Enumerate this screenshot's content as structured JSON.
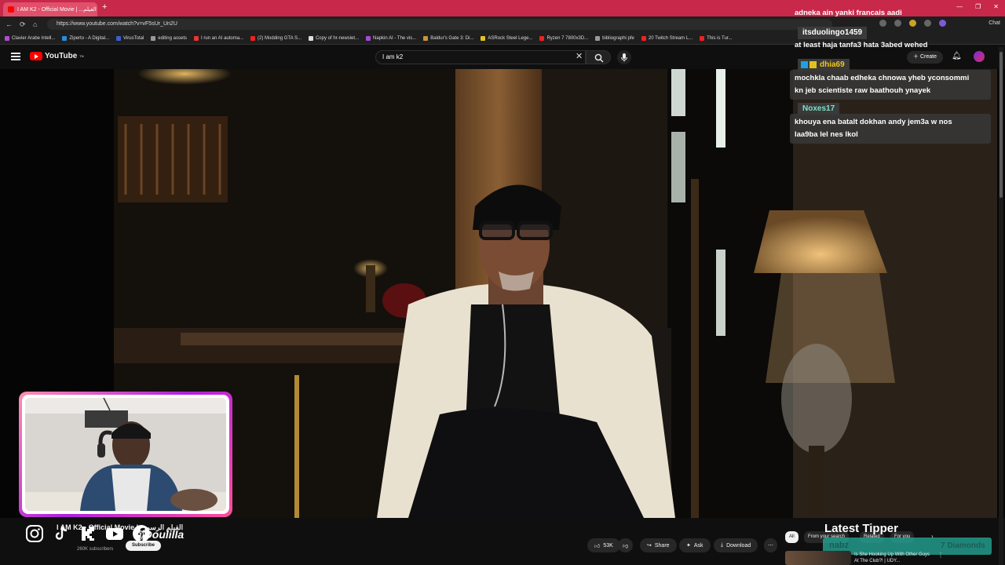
{
  "browser": {
    "tab_title": "I AM K2 - Official Movie | ...الفيلم",
    "url": "https://www.youtube.com/watch?v=vF5sUr_Un2U",
    "chat_label": "Chat",
    "bookmarks": [
      "Clavier Arabe Intell...",
      "Ziperto - A Digital...",
      "VirusTotal",
      "editing assets",
      "I run an AI automa...",
      "(2) Modding GTA S...",
      "Copy of hr-newslet...",
      "Napkin AI - The vis...",
      "Baldur's Gate 3: Di...",
      "ASRock Steel Lege...",
      "Ryzen 7 7800x3D...",
      "bibliographi pfe",
      "20 Twitch Stream L...",
      "This is Tur..."
    ]
  },
  "youtube": {
    "logo_text": "YouTube",
    "logo_sup": "TN",
    "search_query": "I am k2",
    "create_label": "Create",
    "video": {
      "title": "I AM K2 - Official Movie | الفيلم الرسمي",
      "subscribers": "260K subscribers",
      "subscribe_label": "Subscribe",
      "likes": "53K",
      "share_label": "Share",
      "ask_label": "Ask",
      "download_label": "Download"
    },
    "chips": [
      "All",
      "From your search",
      "Related",
      "For you"
    ],
    "recommendation": {
      "title": "Is She Hooking Up With Other Guys At The Club?! | UDY..."
    }
  },
  "overlay": {
    "handle": "@Doulilla",
    "social_icons": [
      "instagram-icon",
      "tiktok-icon",
      "kick-icon",
      "youtube-icon",
      "facebook-icon"
    ],
    "chat": [
      {
        "user": "",
        "message": "adneka ain yanki francais aadi"
      },
      {
        "user": "itsduolingo1459",
        "message": "at least haja tanfa3 hata 3abed wehed",
        "color": "#ffffff"
      },
      {
        "user": "dhia69",
        "message_lines": [
          "mochkla chaab edheka chnowa yheb yconsommi",
          "kn jeb scientiste raw baathouh ynayek"
        ],
        "color": "#f5c518"
      },
      {
        "user": "Noxes17",
        "message_lines": [
          "khouya ena batalt dokhan andy jem3a w nos",
          "laa9ba lel nes lkol"
        ],
        "color": "#7fe0c8"
      }
    ],
    "latest_tipper": {
      "title": "Latest Tipper",
      "name": "nabz",
      "amount": "7 Diamonds"
    }
  }
}
